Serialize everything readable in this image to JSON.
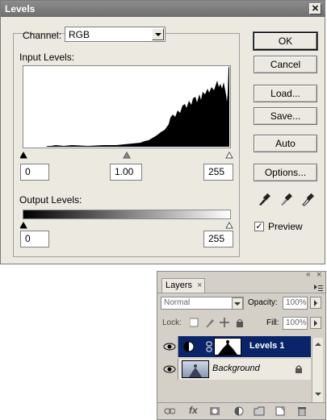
{
  "levels_dialog": {
    "title": "Levels",
    "close_glyph": "✕",
    "channel_label": "Channel:",
    "channel_value": "RGB",
    "input_levels_label": "Input Levels:",
    "input_black": "0",
    "input_gamma": "1.00",
    "input_white": "255",
    "output_levels_label": "Output Levels:",
    "output_black": "0",
    "output_white": "255",
    "buttons": {
      "ok": "OK",
      "cancel": "Cancel",
      "load": "Load...",
      "save": "Save...",
      "auto": "Auto",
      "options": "Options..."
    },
    "preview_label": "Preview",
    "preview_checked": true,
    "check_glyph": "✓"
  },
  "layers_panel": {
    "tab_label": "Layers",
    "tab_close": "×",
    "blend_mode": "Normal",
    "opacity_label": "Opacity:",
    "opacity_value": "100%",
    "lock_label": "Lock:",
    "fill_label": "Fill:",
    "fill_value": "100%",
    "collapse_glyph": "«",
    "close_glyph": "×",
    "layers": [
      {
        "name": "Levels 1",
        "selected": true
      },
      {
        "name": "Background",
        "selected": false
      }
    ],
    "bottom_icons": [
      "link-icon",
      "fx-icon",
      "mask-icon",
      "adjustment-icon",
      "group-folder-icon",
      "new-layer-icon",
      "trash-icon"
    ],
    "fx_text": "fx",
    "colors": {
      "selection": "#0a246a"
    }
  }
}
